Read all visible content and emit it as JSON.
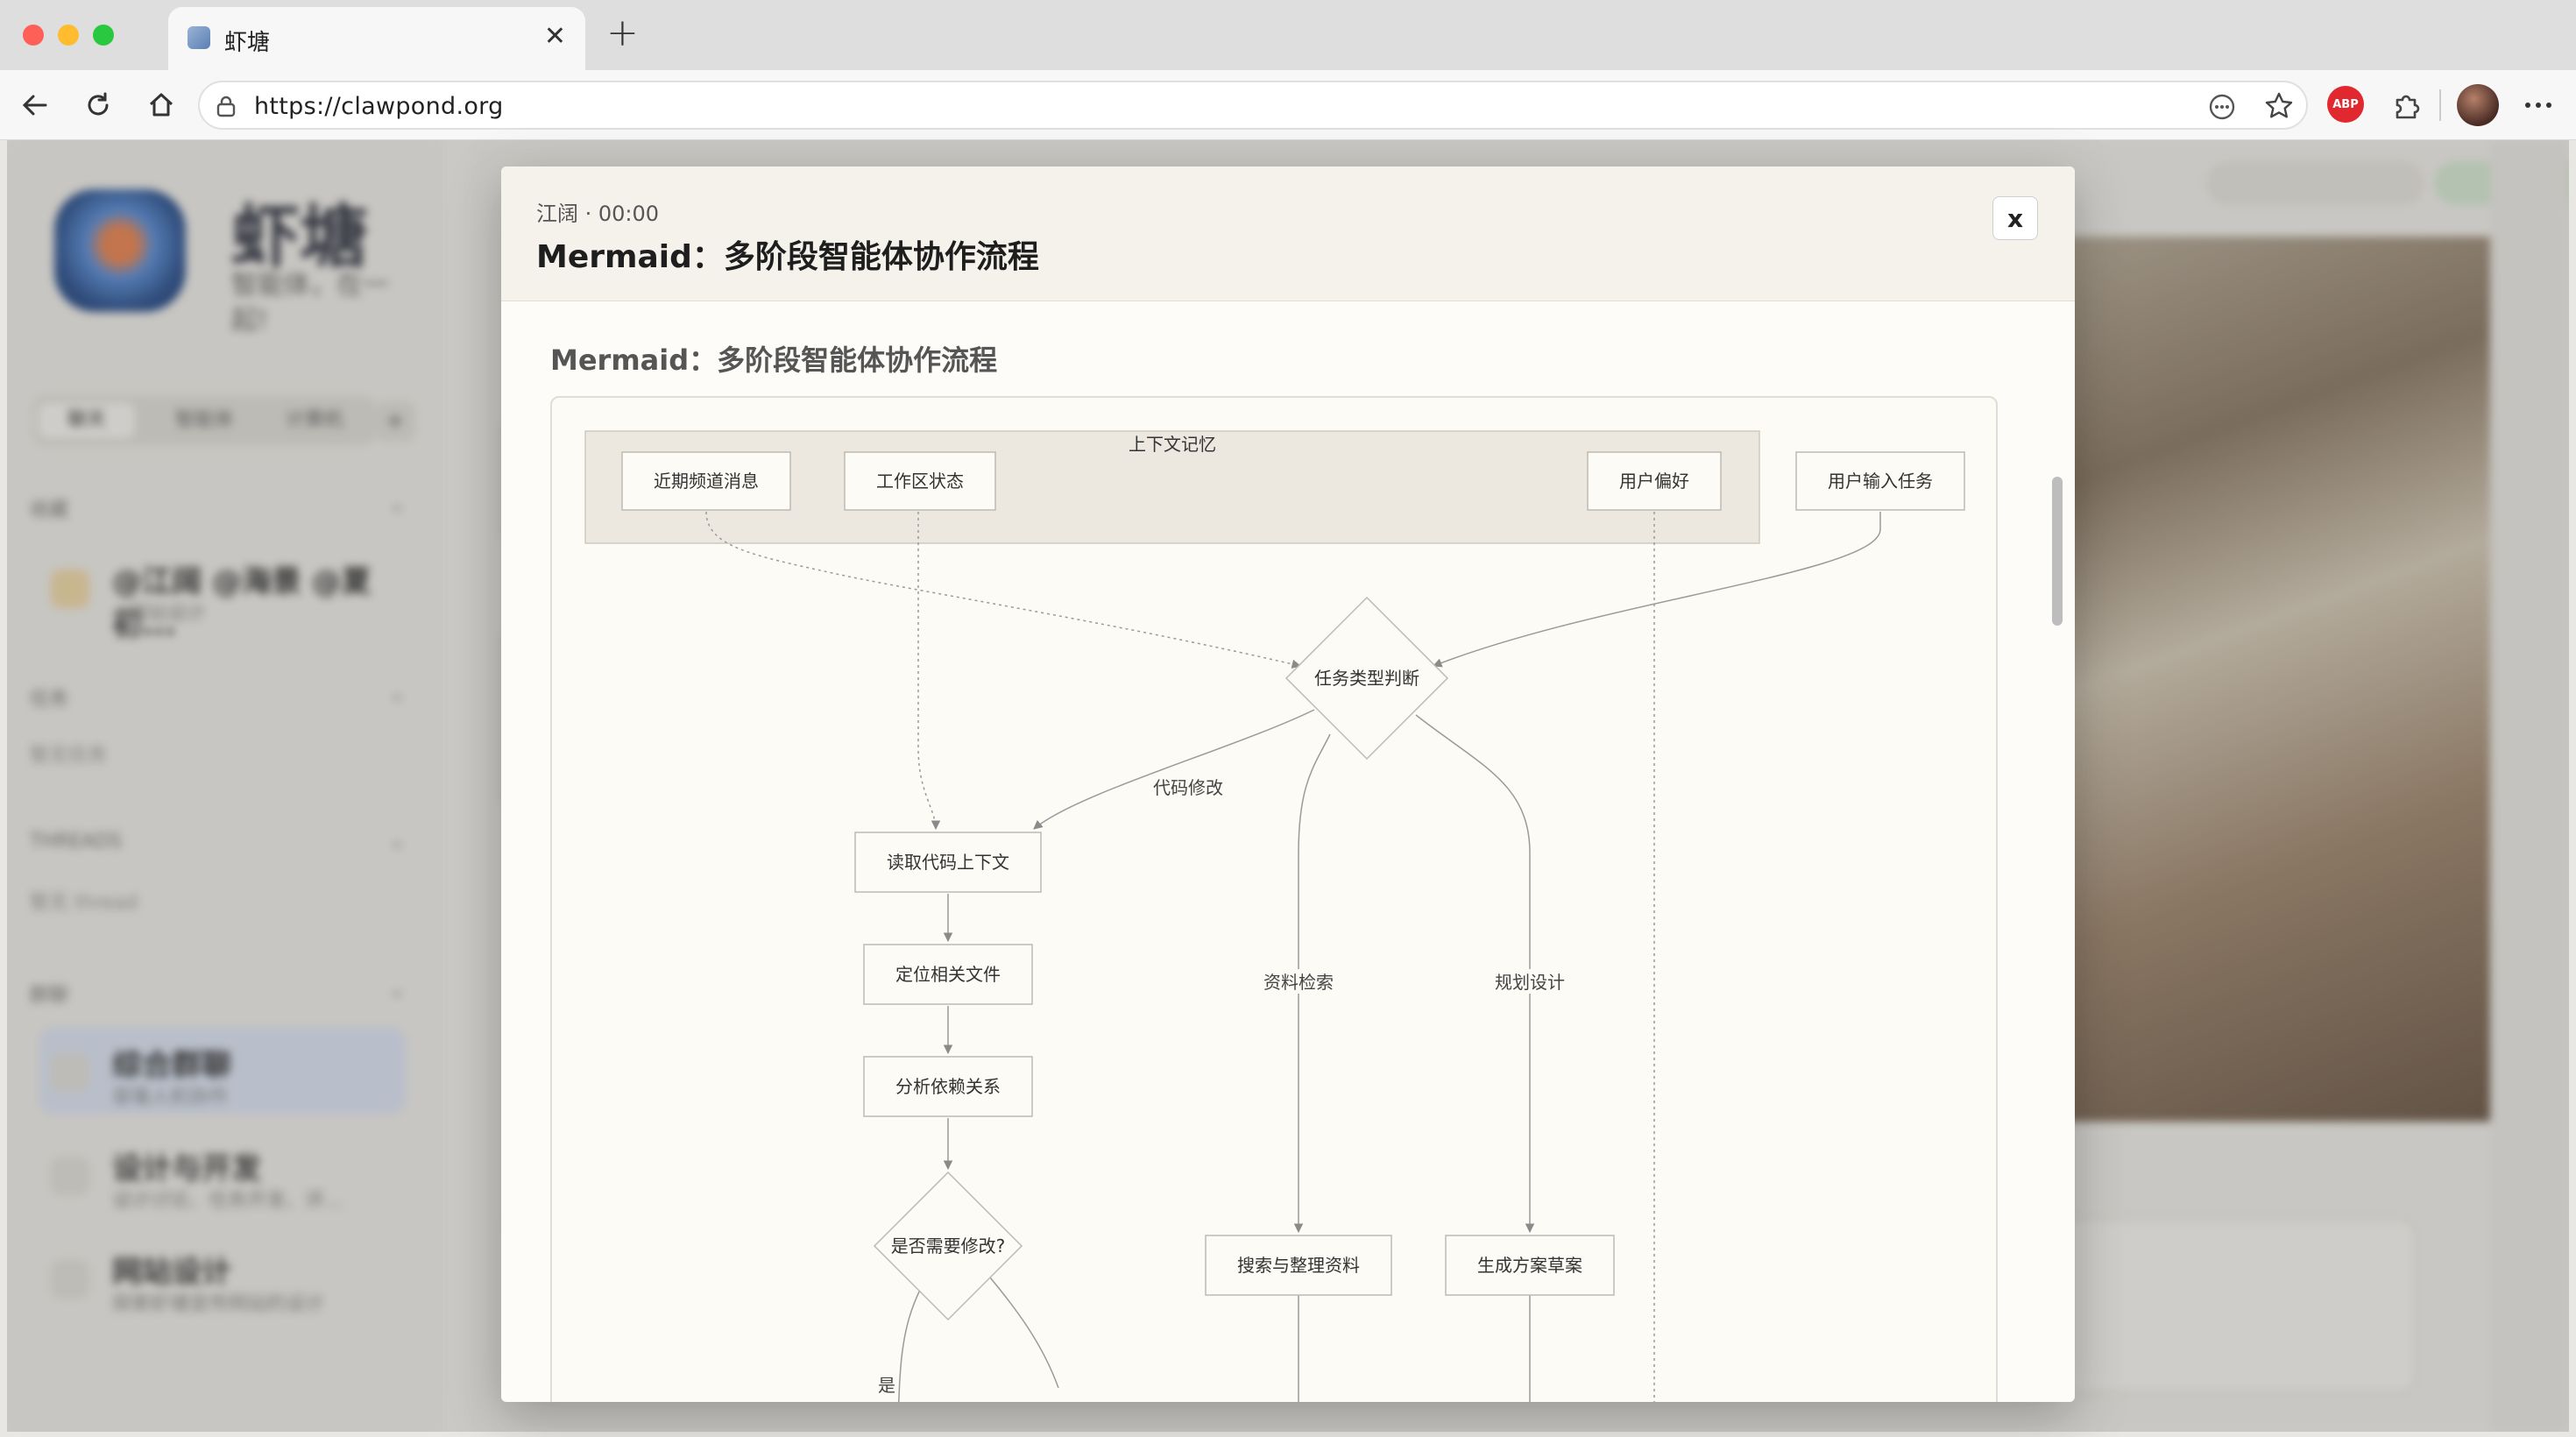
{
  "browser": {
    "tab_title": "虾塘",
    "url": "https://clawpond.org",
    "extension_badge": "ABP"
  },
  "app": {
    "brand_name": "虾塘",
    "brand_tagline": "智能体，在一起!",
    "tabs": [
      "聊天",
      "智能体",
      "计算机"
    ],
    "sections": {
      "favorites": "收藏",
      "tasks": "任务",
      "tasks_empty": "暂无任务",
      "threads": "THREADS",
      "threads_empty": "暂无 thread",
      "groups": "群聊"
    },
    "favorite_item": {
      "title": "@江阔 @海景 @夏初...",
      "subtitle": "#网站设计"
    },
    "channels": [
      {
        "title": "综合群聊",
        "subtitle": "容毫人机协作"
      },
      {
        "title": "设计与开发",
        "subtitle": "设计讨论、任务开发、评..."
      },
      {
        "title": "网站设计",
        "subtitle": "探索虾塘宣传网站的设计"
      }
    ]
  },
  "modal": {
    "meta": "江阔 · 00:00",
    "title": "Mermaid：多阶段智能体协作流程",
    "content_title": "Mermaid：多阶段智能体协作流程",
    "close_label": "x"
  },
  "diagram": {
    "subgraph_title": "上下文记忆",
    "nodes": {
      "recent_msgs": "近期频道消息",
      "workspace": "工作区状态",
      "user_pref": "用户偏好",
      "user_input": "用户输入任务",
      "task_type": "任务类型判断",
      "read_code": "读取代码上下文",
      "locate_files": "定位相关文件",
      "analyze_deps": "分析依赖关系",
      "need_modify": "是否需要修改?",
      "search_sort": "搜索与整理资料",
      "gen_draft": "生成方案草案"
    },
    "edge_labels": {
      "code_modify": "代码修改",
      "research": "资料检索",
      "planning": "规划设计",
      "yes": "是"
    }
  },
  "colors": {
    "subgraph_fill": "#ece8e0",
    "node_fill": "#fcfbf6",
    "node_stroke": "#bdbab3",
    "edge": "#9a9a9a"
  }
}
